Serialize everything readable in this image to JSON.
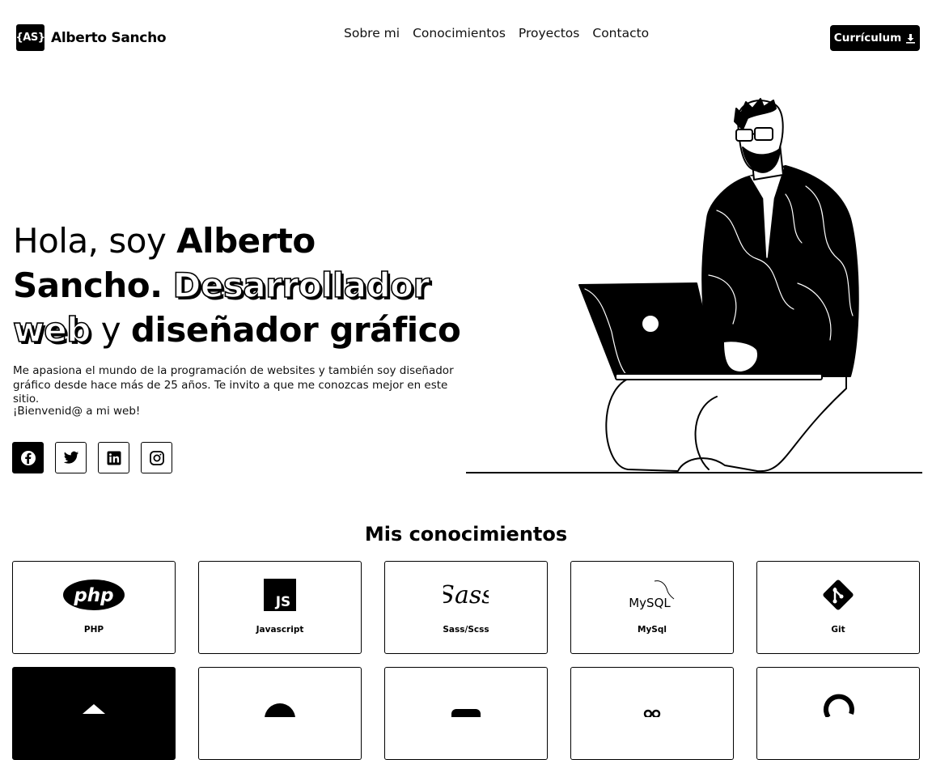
{
  "header": {
    "logo_mark": "{AS}",
    "logo_text": "Alberto Sancho",
    "nav": [
      "Sobre mi",
      "Conocimientos",
      "Proyectos",
      "Contacto"
    ],
    "cv_button": "Currículum"
  },
  "hero": {
    "t1": "Hola, soy ",
    "t2": "Alberto Sancho.",
    "t3": "Desarrollador web",
    "t4": " y ",
    "t5": "diseñador gráfico",
    "description": "Me apasiona el mundo de la programación de websites y también soy diseñador gráfico desde hace más de 25 años. Te invito a que me conozcas mejor en este sitio.",
    "welcome": "¡Bienvenid@ a mi web!",
    "socials": [
      "facebook-icon",
      "twitter-icon",
      "linkedin-icon",
      "instagram-icon"
    ]
  },
  "skills": {
    "title_light": "Mis ",
    "title_bold": "conocimientos",
    "items": [
      {
        "label": "PHP",
        "icon": "php-icon"
      },
      {
        "label": "Javascript",
        "icon": "js-icon"
      },
      {
        "label": "Sass/Scss",
        "icon": "sass-icon"
      },
      {
        "label": "MySql",
        "icon": "mysql-icon"
      },
      {
        "label": "Git",
        "icon": "git-icon"
      }
    ]
  }
}
